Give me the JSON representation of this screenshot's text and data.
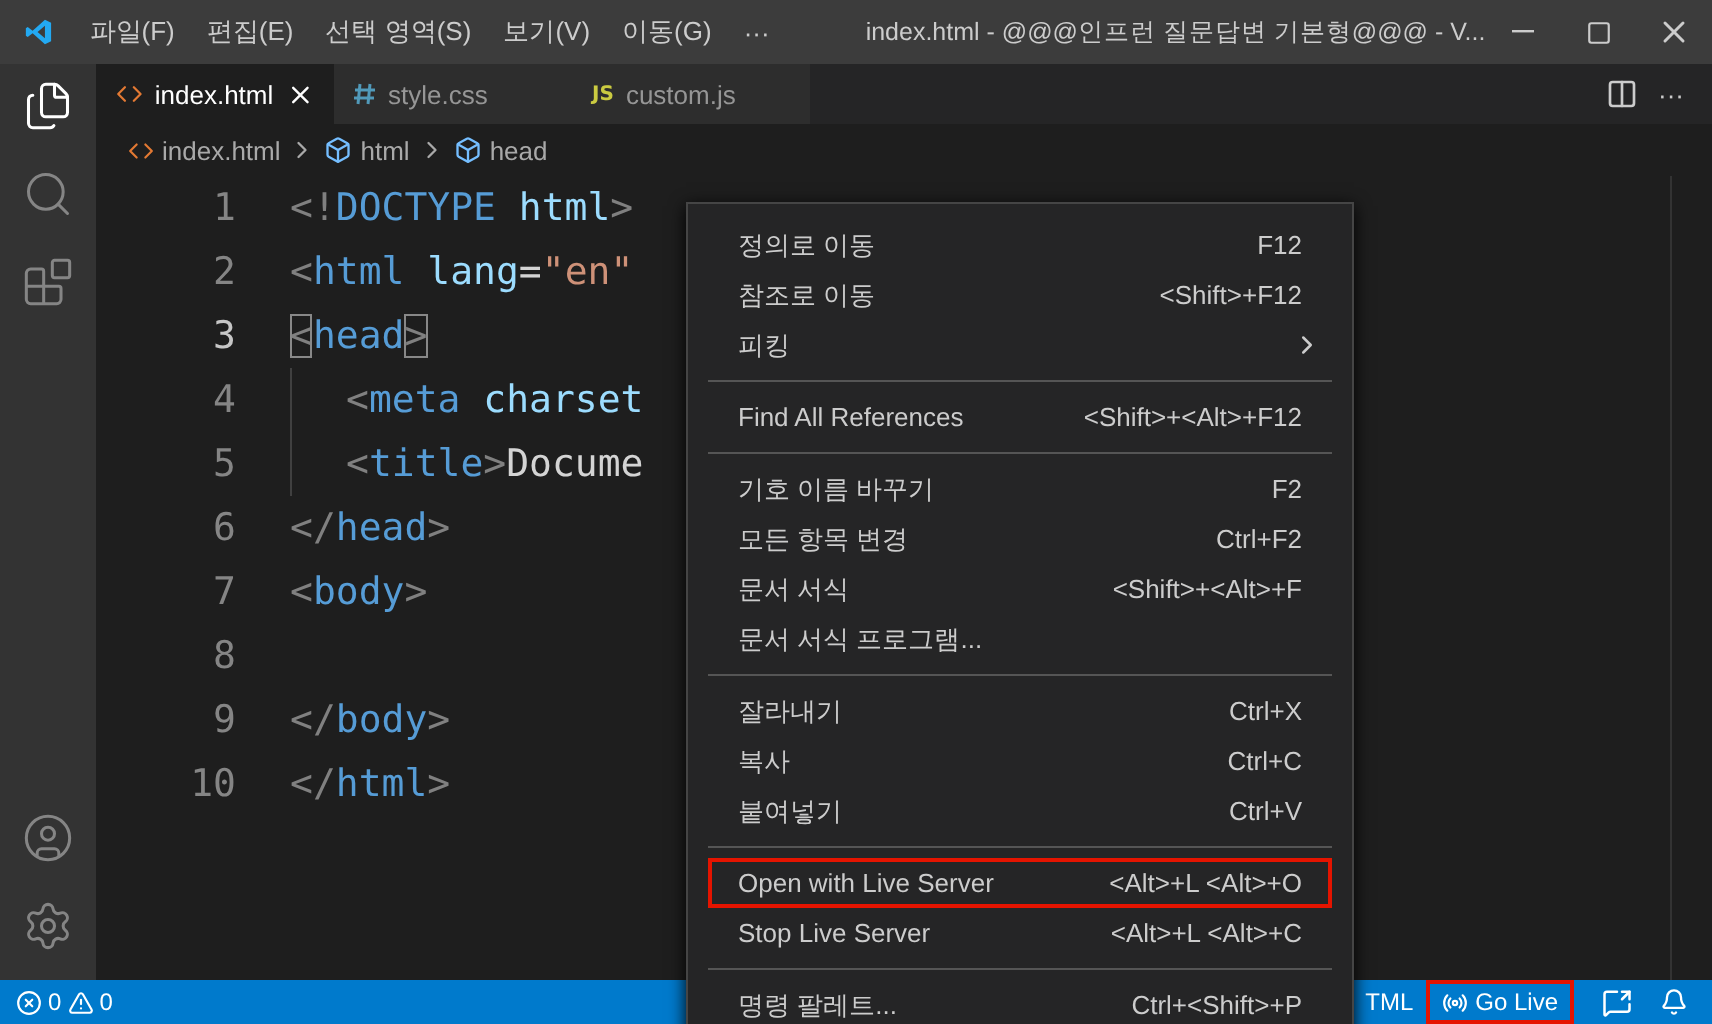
{
  "titlebar": {
    "menus": [
      "파일(F)",
      "편집(E)",
      "선택 영역(S)",
      "보기(V)",
      "이동(G)",
      "···"
    ],
    "title": "index.html - @@@인프런 질문답변 기본형@@@ - V..."
  },
  "tabs": [
    {
      "label": "index.html",
      "kind": "html",
      "selected": true
    },
    {
      "label": "style.css",
      "kind": "css",
      "selected": false
    },
    {
      "label": "custom.js",
      "kind": "js",
      "badge": "JS",
      "selected": false
    }
  ],
  "tab_actions": {
    "more": "···"
  },
  "breadcrumb": [
    {
      "label": "index.html",
      "kind": "html"
    },
    {
      "label": "html",
      "kind": "symbol"
    },
    {
      "label": "head",
      "kind": "symbol"
    }
  ],
  "code": [
    {
      "number": "1",
      "current": false,
      "indented": false,
      "tokens": [
        {
          "kind": "punct",
          "text": "<!"
        },
        {
          "kind": "keyword",
          "text": "DOCTYPE"
        },
        {
          "kind": "attr",
          "text": " html"
        },
        {
          "kind": "punct",
          "text": ">"
        }
      ]
    },
    {
      "number": "2",
      "current": false,
      "indented": false,
      "tokens": [
        {
          "kind": "punct",
          "text": "<"
        },
        {
          "kind": "keyword",
          "text": "html"
        },
        {
          "kind": "attr",
          "text": " lang"
        },
        {
          "kind": "plain",
          "text": "="
        },
        {
          "kind": "string",
          "text": "\"en\""
        }
      ]
    },
    {
      "number": "3",
      "current": true,
      "indented": false,
      "tokens": [
        {
          "kind": "match",
          "text": "<"
        },
        {
          "kind": "keyword",
          "text": "head"
        },
        {
          "kind": "match",
          "text": ">"
        }
      ]
    },
    {
      "number": "4",
      "current": false,
      "indented": true,
      "tokens": [
        {
          "kind": "punct",
          "text": "<"
        },
        {
          "kind": "keyword",
          "text": "meta"
        },
        {
          "kind": "attr",
          "text": " charset"
        }
      ]
    },
    {
      "number": "5",
      "current": false,
      "indented": true,
      "tokens": [
        {
          "kind": "punct",
          "text": "<"
        },
        {
          "kind": "keyword",
          "text": "title"
        },
        {
          "kind": "punct",
          "text": ">"
        },
        {
          "kind": "plain",
          "text": "Docume"
        }
      ]
    },
    {
      "number": "6",
      "current": false,
      "indented": false,
      "tokens": [
        {
          "kind": "punct",
          "text": "</"
        },
        {
          "kind": "keyword",
          "text": "head"
        },
        {
          "kind": "punct",
          "text": ">"
        }
      ]
    },
    {
      "number": "7",
      "current": false,
      "indented": false,
      "tokens": [
        {
          "kind": "punct",
          "text": "<"
        },
        {
          "kind": "keyword",
          "text": "body"
        },
        {
          "kind": "punct",
          "text": ">"
        }
      ]
    },
    {
      "number": "8",
      "current": false,
      "indented": false
    },
    {
      "number": "9",
      "current": false,
      "indented": false,
      "tokens": [
        {
          "kind": "punct",
          "text": "</"
        },
        {
          "kind": "keyword",
          "text": "body"
        },
        {
          "kind": "punct",
          "text": ">"
        }
      ]
    },
    {
      "number": "10",
      "current": false,
      "indented": false,
      "tokens": [
        {
          "kind": "punct",
          "text": "</"
        },
        {
          "kind": "keyword",
          "text": "html"
        },
        {
          "kind": "punct",
          "text": ">"
        }
      ]
    }
  ],
  "context_menu": [
    [
      {
        "label": "정의로 이동",
        "shortcut": "F12",
        "submenu": false,
        "outlined": false
      },
      {
        "label": "참조로 이동",
        "shortcut": "<Shift>+F12",
        "submenu": false,
        "outlined": false
      },
      {
        "label": "피킹",
        "submenu": true,
        "outlined": false
      }
    ],
    [
      {
        "label": "Find All References",
        "shortcut": "<Shift>+<Alt>+F12",
        "submenu": false,
        "outlined": false
      }
    ],
    [
      {
        "label": "기호 이름 바꾸기",
        "shortcut": "F2",
        "submenu": false,
        "outlined": false
      },
      {
        "label": "모든 항목 변경",
        "shortcut": "Ctrl+F2",
        "submenu": false,
        "outlined": false
      },
      {
        "label": "문서 서식",
        "shortcut": "<Shift>+<Alt>+F",
        "submenu": false,
        "outlined": false
      },
      {
        "label": "문서 서식 프로그램...",
        "submenu": false,
        "outlined": false
      }
    ],
    [
      {
        "label": "잘라내기",
        "shortcut": "Ctrl+X",
        "submenu": false,
        "outlined": false
      },
      {
        "label": "복사",
        "shortcut": "Ctrl+C",
        "submenu": false,
        "outlined": false
      },
      {
        "label": "붙여넣기",
        "shortcut": "Ctrl+V",
        "submenu": false,
        "outlined": false
      }
    ],
    [
      {
        "label": "Open with Live Server",
        "shortcut": "<Alt>+L <Alt>+O",
        "submenu": false,
        "outlined": true
      },
      {
        "label": "Stop Live Server",
        "shortcut": "<Alt>+L <Alt>+C",
        "submenu": false,
        "outlined": false
      }
    ],
    [
      {
        "label": "명령 팔레트...",
        "shortcut": "Ctrl+<Shift>+P",
        "submenu": false,
        "outlined": false
      }
    ]
  ],
  "status_bar": {
    "errors": "0",
    "warnings": "0",
    "language": "TML",
    "go_live": {
      "label": "Go Live",
      "outlined": true
    }
  }
}
